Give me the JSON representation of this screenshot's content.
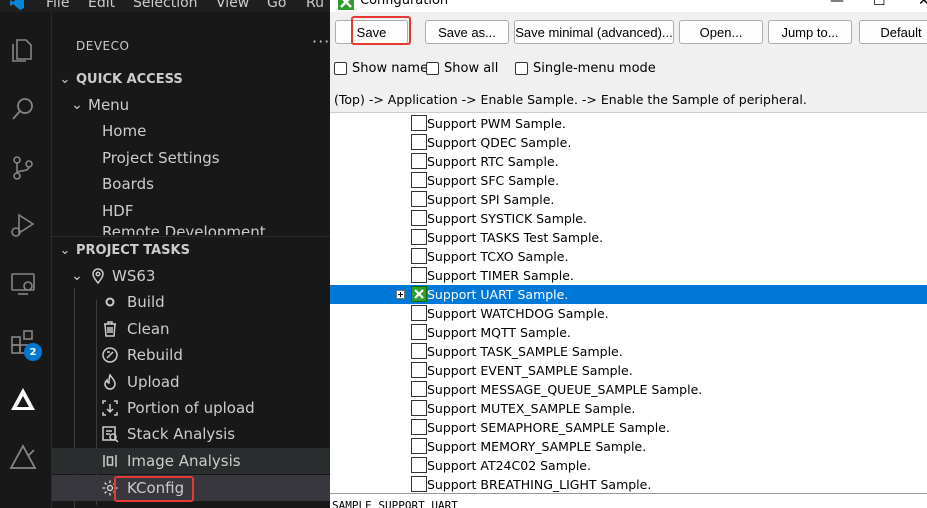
{
  "menubar": {
    "items": [
      "File",
      "Edit",
      "Selection",
      "View",
      "Go",
      "Ru"
    ]
  },
  "activity_bar": {
    "icons": [
      "explorer-icon",
      "search-icon",
      "source-control-icon",
      "run-debug-icon",
      "remote-explorer-icon",
      "extensions-icon",
      "deveco-icon",
      "deveco-tools-icon"
    ],
    "extensions_badge": "2"
  },
  "sidebar": {
    "title": "DEVECO",
    "more": "···",
    "quick_access": {
      "header": "QUICK ACCESS",
      "menu_label": "Menu",
      "items": [
        "Home",
        "Project Settings",
        "Boards",
        "HDF",
        "Remote Development"
      ]
    },
    "project_tasks": {
      "header": "PROJECT TASKS",
      "project": "WS63",
      "tasks": [
        "Build",
        "Clean",
        "Rebuild",
        "Upload",
        "Portion of upload",
        "Stack Analysis",
        "Image Analysis",
        "KConfig"
      ]
    }
  },
  "config": {
    "window_title": "Configuration",
    "toolbar": {
      "save": "Save",
      "save_as": "Save as...",
      "save_minimal": "Save minimal (advanced)...",
      "open": "Open...",
      "jump_to": "Jump to...",
      "default": "Default"
    },
    "options": {
      "show_name": "Show name",
      "show_all": "Show all",
      "single_menu": "Single-menu mode"
    },
    "breadcrumb": "(Top) -> Application -> Enable Sample. -> Enable the Sample of peripheral.",
    "items": [
      "Support PWM Sample.",
      "Support QDEC Sample.",
      "Support RTC Sample.",
      "Support SFC Sample.",
      "Support SPI Sample.",
      "Support SYSTICK Sample.",
      "Support TASKS Test Sample.",
      "Support TCXO Sample.",
      "Support TIMER Sample.",
      "Support UART Sample.",
      "Support WATCHDOG Sample.",
      "Support MQTT Sample.",
      "Support TASK_SAMPLE Sample.",
      "Support EVENT_SAMPLE Sample.",
      "Support MESSAGE_QUEUE_SAMPLE Sample.",
      "Support MUTEX_SAMPLE Sample.",
      "Support SEMAPHORE_SAMPLE Sample.",
      "Support MEMORY_SAMPLE Sample.",
      "Support AT24C02 Sample.",
      "Support BREATHING_LIGHT Sample."
    ],
    "selected_item": "Support UART Sample.",
    "status_text": "SAMPLE_SUPPORT_UART"
  },
  "colors": {
    "accent": "#0078d7",
    "highlight": "#e53935",
    "badge": "#0078d4"
  }
}
